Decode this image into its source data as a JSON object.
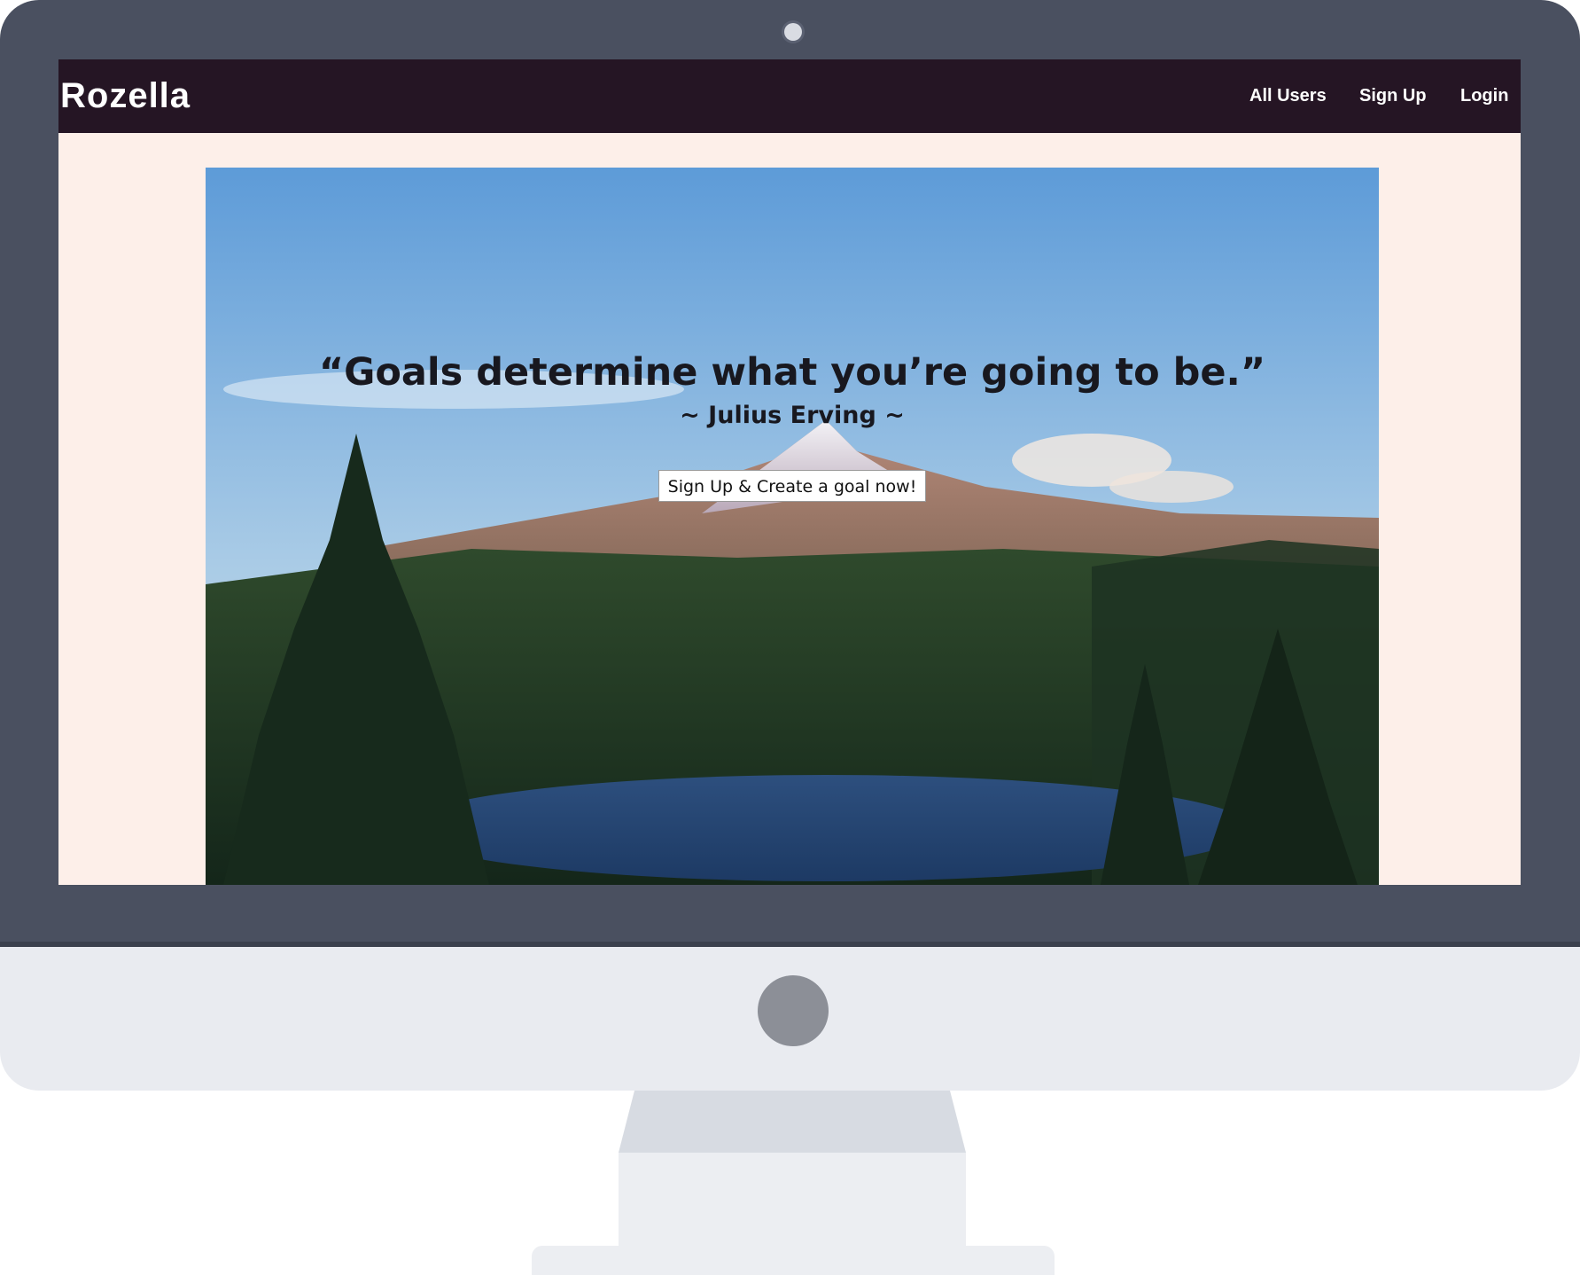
{
  "navbar": {
    "brand": "Rozella",
    "links": [
      "All Users",
      "Sign Up",
      "Login"
    ]
  },
  "hero": {
    "quote": "“Goals determine what you’re going to be.”",
    "author": "~ Julius Erving ~",
    "cta_label": "Sign Up & Create a goal now!"
  },
  "colors": {
    "navbar_bg": "#251524",
    "page_bg": "#fdefe9",
    "bezel": "#4a5060",
    "chin": "#e9ebf0"
  }
}
